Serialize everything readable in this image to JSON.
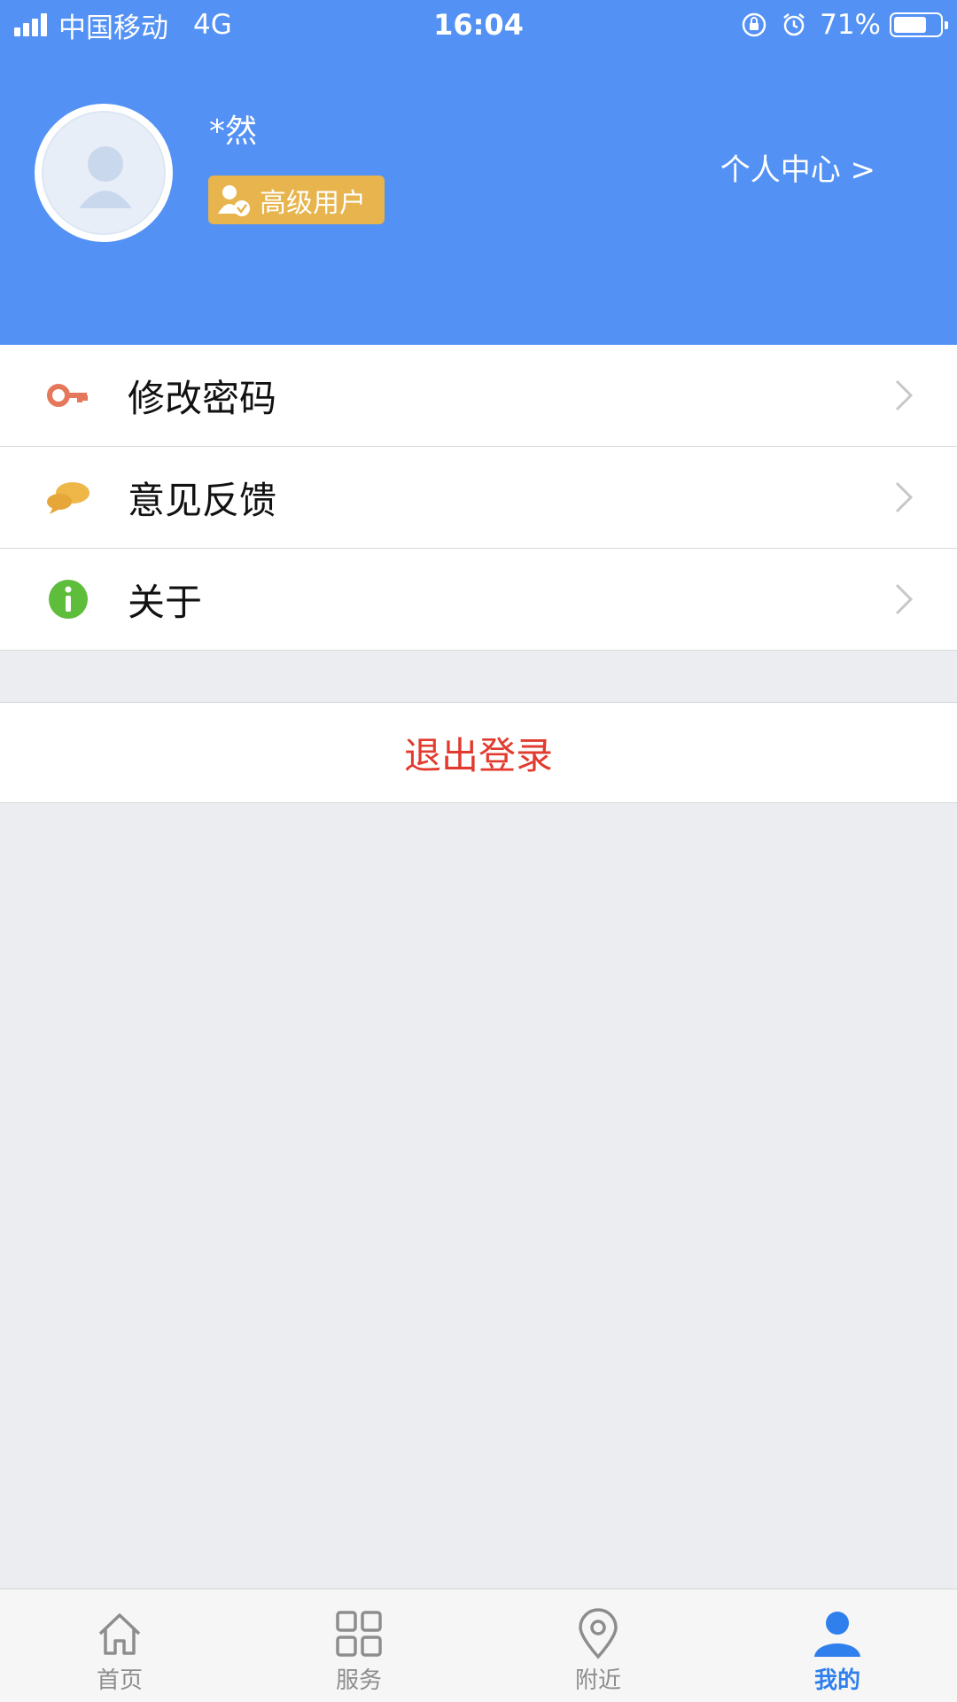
{
  "status_bar": {
    "carrier": "中国移动",
    "network": "4G",
    "time": "16:04",
    "battery": "71%",
    "battery_level": 0.71
  },
  "profile": {
    "username": "*然",
    "badge": "高级用户",
    "center_link": "个人中心 >"
  },
  "menu": {
    "items": [
      {
        "label": "修改密码",
        "icon": "key-icon"
      },
      {
        "label": "意见反馈",
        "icon": "chat-bubbles-icon"
      },
      {
        "label": "关于",
        "icon": "info-icon"
      }
    ]
  },
  "logout": {
    "label": "退出登录"
  },
  "tabbar": {
    "tabs": [
      {
        "label": "首页",
        "icon": "home-icon"
      },
      {
        "label": "服务",
        "icon": "grid-icon"
      },
      {
        "label": "附近",
        "icon": "location-pin-icon"
      },
      {
        "label": "我的",
        "icon": "user-icon",
        "active": true
      }
    ]
  },
  "colors": {
    "header_bg": "#5391f4",
    "badge_bg": "#e7b44d",
    "logout_text": "#e23a2e",
    "tab_active": "#2f80ed"
  }
}
